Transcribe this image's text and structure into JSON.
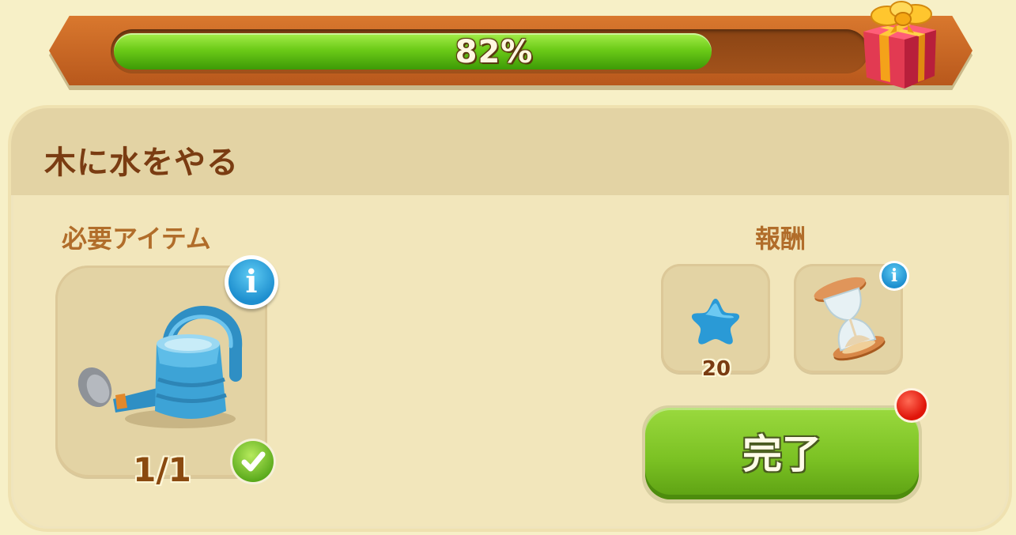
{
  "progress": {
    "percent_label": "82%",
    "value": 0.82,
    "fill_color": "#6ccb18",
    "track_color": "#a2521b",
    "reward_icon": "gift-box-icon"
  },
  "task": {
    "title": "木に水をやる"
  },
  "required": {
    "label": "必要アイテム",
    "item_icon": "watering-can-icon",
    "count": "1/1",
    "completed": true
  },
  "rewards": {
    "label": "報酬",
    "items": [
      {
        "icon": "blue-star-icon",
        "count": "20"
      },
      {
        "icon": "hourglass-icon",
        "count": ""
      }
    ]
  },
  "complete_button": {
    "label": "完了",
    "color": "#7cc224",
    "has_notification": true
  }
}
